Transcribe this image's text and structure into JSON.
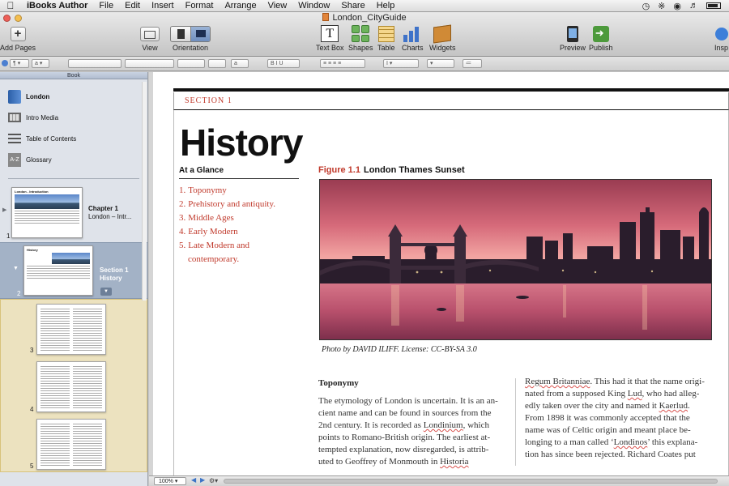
{
  "menubar": {
    "app_name": "iBooks Author",
    "items": [
      "File",
      "Edit",
      "Insert",
      "Format",
      "Arrange",
      "View",
      "Window",
      "Share",
      "Help"
    ]
  },
  "window": {
    "title": "London_CityGuide"
  },
  "toolbar": {
    "add_pages": "Add Pages",
    "view": "View",
    "orientation": "Orientation",
    "text_box": "Text Box",
    "shapes": "Shapes",
    "table": "Table",
    "charts": "Charts",
    "widgets": "Widgets",
    "preview": "Preview",
    "publish": "Publish",
    "inspector": "Insp"
  },
  "sidebar": {
    "header": "Book",
    "items": [
      {
        "label": "London",
        "icon": "book-icon"
      },
      {
        "label": "Intro Media",
        "icon": "film-icon"
      },
      {
        "label": "Table of Contents",
        "icon": "list-icon"
      },
      {
        "label": "Glossary",
        "icon": "az-icon"
      }
    ],
    "chapter": {
      "thumb_title": "London - Introduction",
      "title": "Chapter 1",
      "subtitle": "London – Intr...",
      "page": "1"
    },
    "section": {
      "thumb_title": "History",
      "title": "Section 1",
      "subtitle": "History",
      "page": "2"
    },
    "pages": [
      "3",
      "4",
      "5"
    ]
  },
  "page": {
    "section_label": "SECTION 1",
    "heading": "History",
    "glance_title": "At a Glance",
    "glance_items": [
      {
        "num": "1.",
        "text": "Toponymy"
      },
      {
        "num": "2.",
        "text": "Prehistory and antiquity."
      },
      {
        "num": "3.",
        "text": "Middle Ages"
      },
      {
        "num": "4.",
        "text": "Early Modern"
      },
      {
        "num": "5.",
        "text": "Late Modern and",
        "cont": "contemporary."
      }
    ],
    "figure_number": "Figure 1.1",
    "figure_title": "London Thames Sunset",
    "photo_credit": "Photo by DAVID ILIFF. License: CC-BY-SA 3.0",
    "column_heading": "Toponymy",
    "left_column_lines": [
      "The etymology of London is uncertain. It is an an-",
      "cient name and can be found in sources from the",
      "2nd century. It is recorded as",
      "points to Romano-British origin. The earliest at-",
      "tempted explanation, now disregarded, is attrib-",
      "uted to Geoffrey of Monmouth in"
    ],
    "left_inline": {
      "londinium": "Londinium",
      "londinium_after": ", which",
      "historia": "Historia"
    },
    "right_column_lines": [
      "nated from a supposed King",
      "edly taken over the city and named it",
      "From 1898 it was commonly accepted that the",
      "name was of Celtic origin and meant place be-",
      "longing to a man called",
      "tion has since been rejected. Richard Coates put"
    ],
    "right_inline": {
      "regum": "Regum Britanniae",
      "regum_after": ". This had it that the name origi-",
      "lud": "Lud",
      "lud_after": ", who had alleg-",
      "kaerlud": "Kaerlud",
      "kaerlud_after": ".",
      "londinos_pre": "‘",
      "londinos": "Londinos",
      "londinos_after": "’ this explana-"
    }
  },
  "statusbar": {
    "zoom": "100%"
  },
  "colors": {
    "accent_red": "#c0392b",
    "selection_blue": "#a3b2c6",
    "sidebar_bg": "#dfe3ea"
  }
}
